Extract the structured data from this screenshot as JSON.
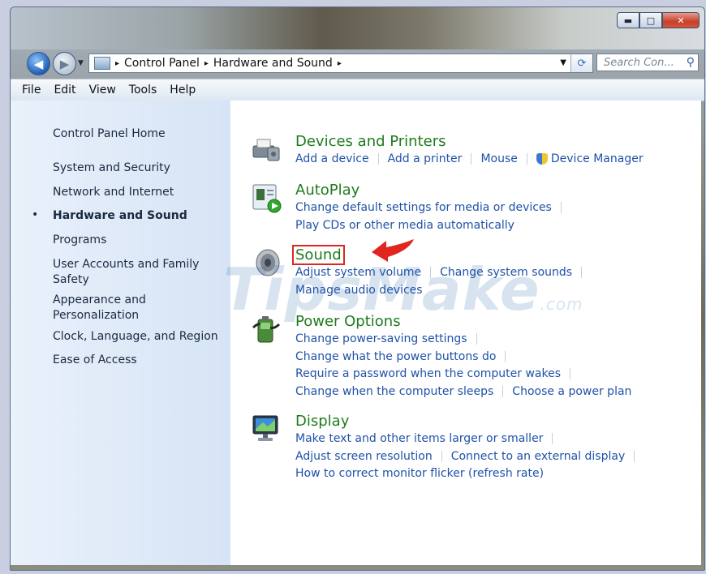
{
  "window": {
    "min_glyph": "▬",
    "max_glyph": "□",
    "close_glyph": "✕"
  },
  "address": {
    "crumbs": [
      "Control Panel",
      "Hardware and Sound"
    ],
    "separator": "▸",
    "search_placeholder": "Search Con..."
  },
  "menu": [
    "File",
    "Edit",
    "View",
    "Tools",
    "Help"
  ],
  "sidebar": {
    "home": "Control Panel Home",
    "items": [
      {
        "label": "System and Security",
        "active": false
      },
      {
        "label": "Network and Internet",
        "active": false
      },
      {
        "label": "Hardware and Sound",
        "active": true
      },
      {
        "label": "Programs",
        "active": false
      },
      {
        "label": "User Accounts and Family Safety",
        "active": false
      },
      {
        "label": "Appearance and Personalization",
        "active": false
      },
      {
        "label": "Clock, Language, and Region",
        "active": false
      },
      {
        "label": "Ease of Access",
        "active": false
      }
    ],
    "bullet": "•"
  },
  "categories": {
    "devices": {
      "title": "Devices and Printers",
      "icon": "printer-icon",
      "links": [
        "Add a device",
        "Add a printer",
        "Mouse",
        "Device Manager"
      ]
    },
    "autoplay": {
      "title": "AutoPlay",
      "icon": "autoplay-icon",
      "links": [
        "Change default settings for media or devices",
        "Play CDs or other media automatically"
      ]
    },
    "sound": {
      "title": "Sound",
      "icon": "speaker-icon",
      "links": [
        "Adjust system volume",
        "Change system sounds",
        "Manage audio devices"
      ]
    },
    "power": {
      "title": "Power Options",
      "icon": "battery-icon",
      "links": [
        "Change power-saving settings",
        "Change what the power buttons do",
        "Require a password when the computer wakes",
        "Change when the computer sleeps",
        "Choose a power plan"
      ]
    },
    "display": {
      "title": "Display",
      "icon": "monitor-icon",
      "links": [
        "Make text and other items larger or smaller",
        "Adjust screen resolution",
        "Connect to an external display",
        "How to correct monitor flicker (refresh rate)"
      ]
    }
  },
  "watermark": {
    "main": "TipsMake",
    "suffix": ".com"
  },
  "colors": {
    "link": "#1f52a8",
    "category_title": "#1e7b1e",
    "highlight": "#e0261f"
  }
}
